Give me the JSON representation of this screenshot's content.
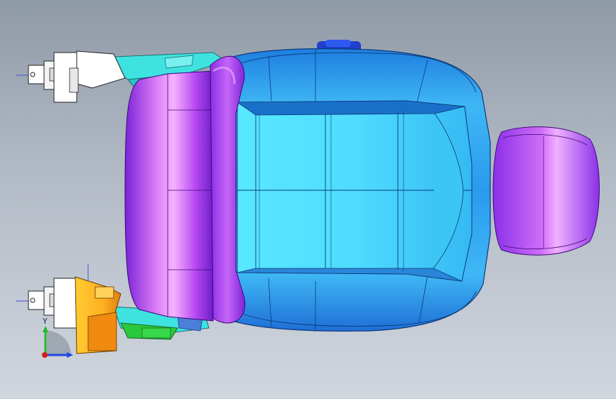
{
  "viewport": {
    "background_top": "#8f9aa7",
    "background_bottom": "#d1d6de"
  },
  "model": {
    "seat_back_color": "#2fa8f0",
    "seat_frame_color": "#9a2cf0",
    "headrest_color": "#a13df0",
    "cushion_color": "#5fe6ff",
    "bracket_colors": [
      "#ffffff",
      "#3ee3e0",
      "#ff9d1a",
      "#2ac83c",
      "#2a55d6"
    ]
  },
  "triad": {
    "x_label": "",
    "y_label": "Y",
    "z_label": "",
    "x_color": "#1f49e0",
    "y_color": "#23b52a",
    "z_color": "#d41c1c"
  }
}
